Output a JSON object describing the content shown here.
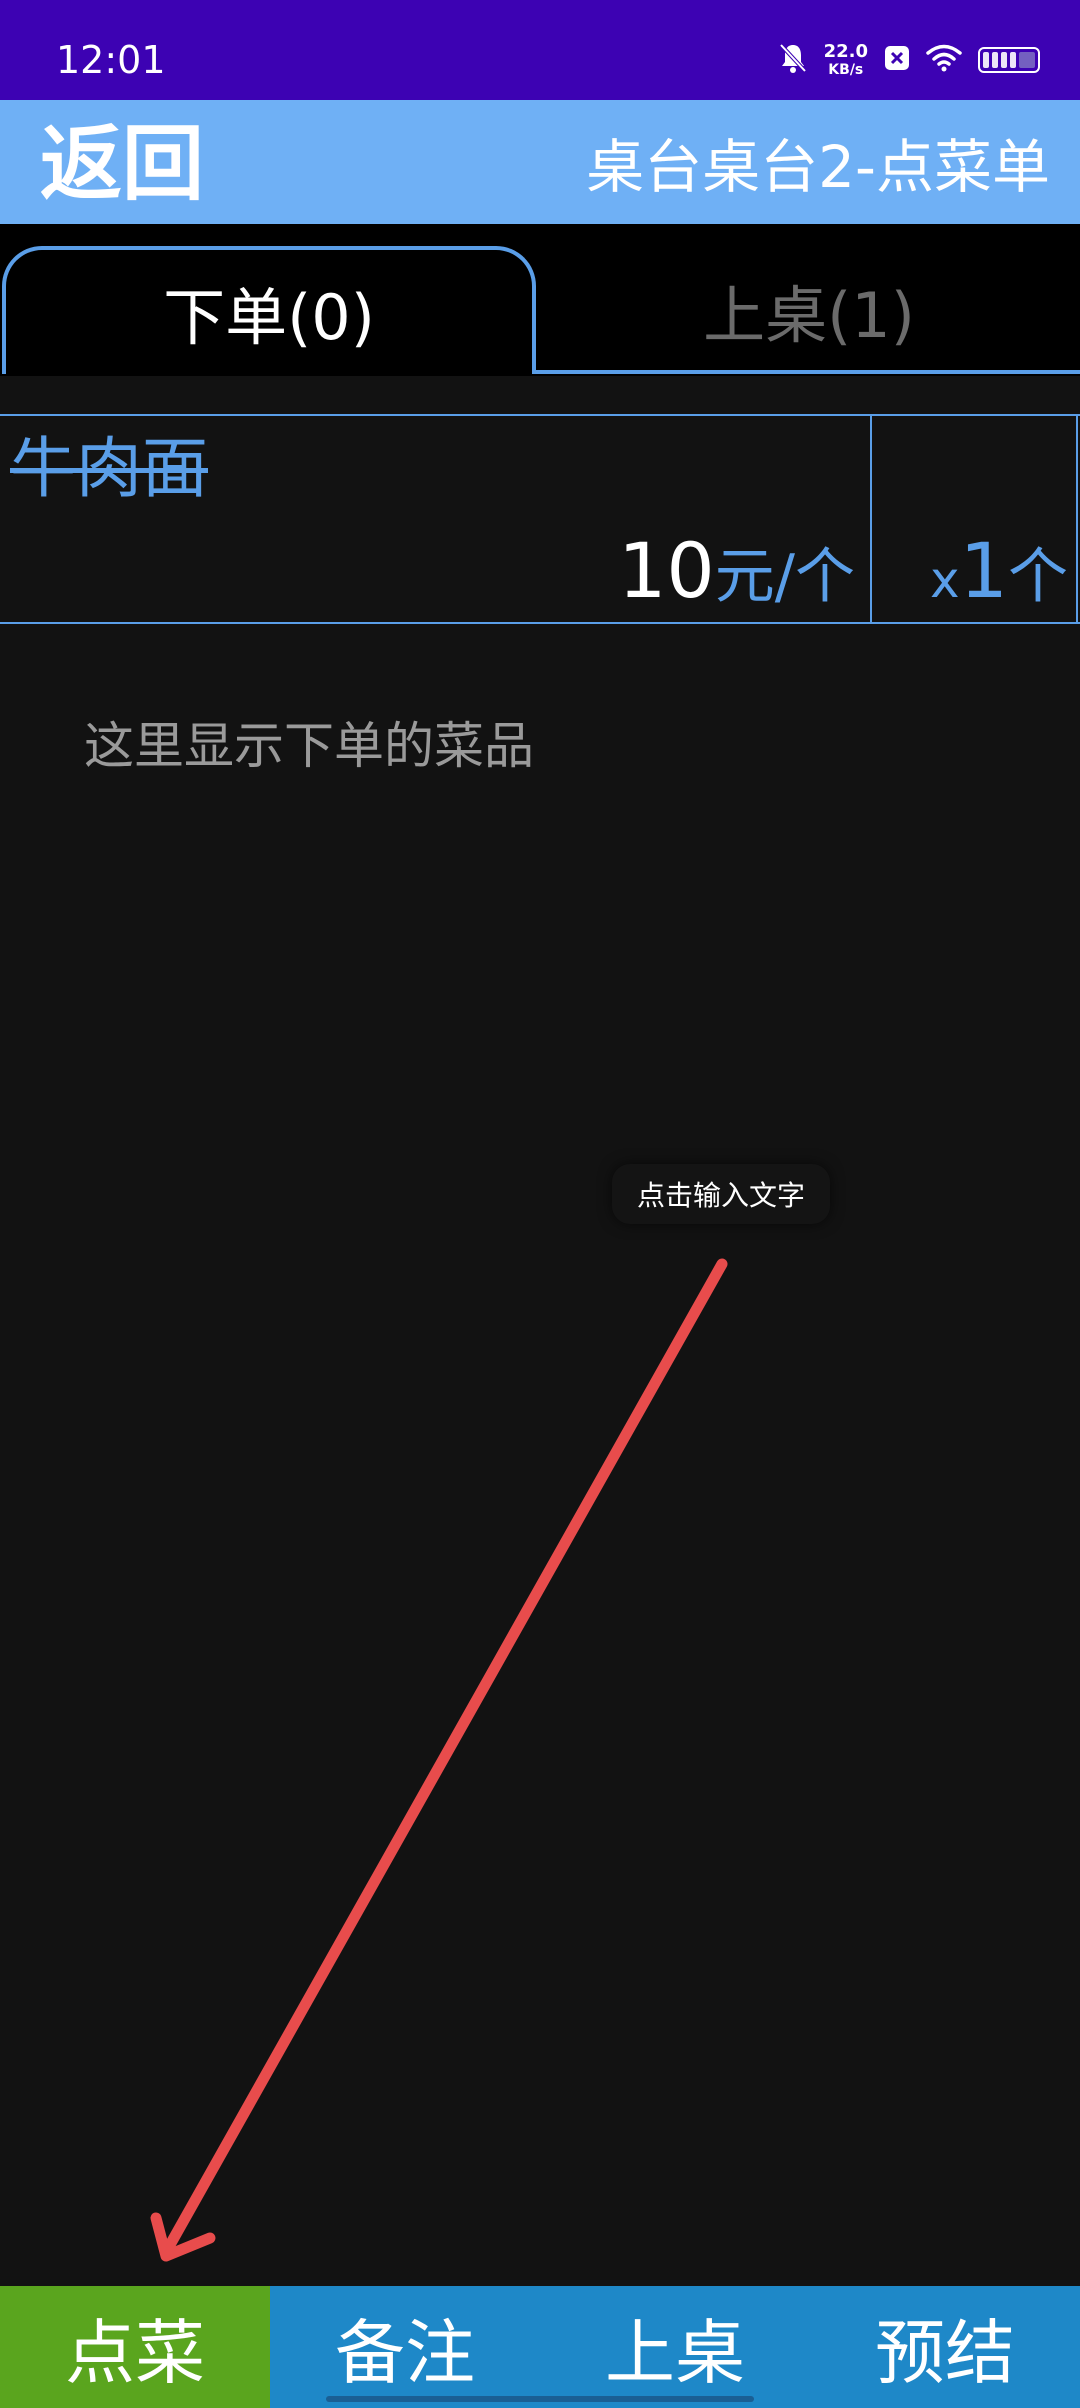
{
  "status_bar": {
    "time": "12:01",
    "net_speed_value": "22.0",
    "net_speed_unit": "KB/s",
    "icons": [
      "mute-bell-icon",
      "close-box-icon",
      "wifi-icon",
      "battery-icon"
    ]
  },
  "header": {
    "back_label": "返回",
    "title": "桌台桌台2-点菜单"
  },
  "tabs": [
    {
      "label": "下单(0)",
      "active": true
    },
    {
      "label": "上桌(1)",
      "active": false
    }
  ],
  "dish": {
    "name": "牛肉面",
    "price": "10",
    "price_unit": "元/个",
    "qty_prefix": "x",
    "qty": "1",
    "qty_unit": "个"
  },
  "hint": "这里显示下单的菜品",
  "tooltip": "点击输入文字",
  "bottom_nav": [
    {
      "label": "点菜",
      "active": true
    },
    {
      "label": "备注",
      "active": false
    },
    {
      "label": "上桌",
      "active": false
    },
    {
      "label": "预结",
      "active": false
    }
  ],
  "colors": {
    "status_bar": "#3d02b3",
    "header": "#6fb0f5",
    "accent_blue": "#5a9ee8",
    "nav_blue": "#1e88c8",
    "nav_active_green": "#5aa51e",
    "arrow_red": "#e84c4c"
  }
}
